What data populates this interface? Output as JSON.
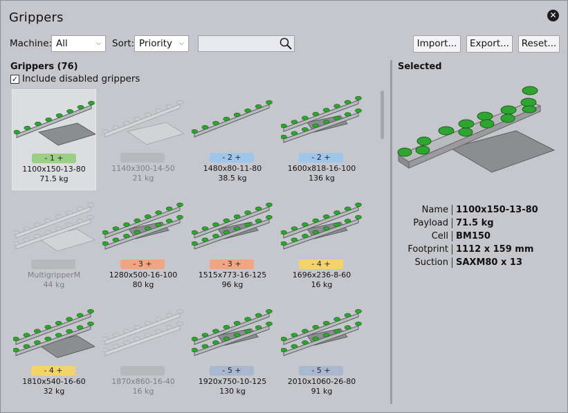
{
  "window": {
    "title": "Grippers",
    "close_icon": "close-icon"
  },
  "toolbar": {
    "machine_label": "Machine:",
    "machine_value": "All",
    "sort_label": "Sort:",
    "sort_value": "Priority",
    "search_value": "",
    "import_label": "Import...",
    "export_label": "Export...",
    "reset_label": "Reset..."
  },
  "list": {
    "title": "Grippers (76)",
    "include_disabled_label": "Include disabled grippers",
    "include_disabled_checked": true,
    "items": [
      {
        "name": "1100x150-13-80",
        "weight": "71.5 kg",
        "priority": "- 1 +",
        "color": "#9ccf84",
        "enabled": true,
        "selected": true
      },
      {
        "name": "1140x300-14-50",
        "weight": "21 kg",
        "priority": "",
        "color": "#b8b9bd",
        "enabled": false
      },
      {
        "name": "1480x80-11-80",
        "weight": "38.5 kg",
        "priority": "- 2 +",
        "color": "#9fc6ea",
        "enabled": true
      },
      {
        "name": "1600x818-16-100",
        "weight": "136 kg",
        "priority": "- 2 +",
        "color": "#9fc6ea",
        "enabled": true
      },
      {
        "name": "MultigripperM",
        "weight": "44 kg",
        "priority": "",
        "color": "#b8b9bd",
        "enabled": false
      },
      {
        "name": "1280x500-16-100",
        "weight": "80 kg",
        "priority": "- 3 +",
        "color": "#f1a583",
        "enabled": true
      },
      {
        "name": "1515x773-16-125",
        "weight": "96 kg",
        "priority": "- 3 +",
        "color": "#f1a583",
        "enabled": true
      },
      {
        "name": "1696x236-8-60",
        "weight": "16 kg",
        "priority": "- 4 +",
        "color": "#f3d36a",
        "enabled": true
      },
      {
        "name": "1810x540-16-60",
        "weight": "32 kg",
        "priority": "- 4 +",
        "color": "#f3d36a",
        "enabled": true
      },
      {
        "name": "1870x860-16-40",
        "weight": "16 kg",
        "priority": "",
        "color": "#b8b9bd",
        "enabled": false
      },
      {
        "name": "1920x750-10-125",
        "weight": "130 kg",
        "priority": "- 5 +",
        "color": "#a9b8cf",
        "enabled": true
      },
      {
        "name": "2010x1060-26-80",
        "weight": "91 kg",
        "priority": "- 5 +",
        "color": "#a9b8cf",
        "enabled": true
      }
    ]
  },
  "selected": {
    "title": "Selected",
    "props": [
      {
        "key": "Name",
        "value": "1100x150-13-80"
      },
      {
        "key": "Payload",
        "value": "71.5 kg"
      },
      {
        "key": "Cell",
        "value": "BM150"
      },
      {
        "key": "Footprint",
        "value": "1112 x 159 mm"
      },
      {
        "key": "Suction",
        "value": "SAXM80 x 13"
      }
    ]
  }
}
